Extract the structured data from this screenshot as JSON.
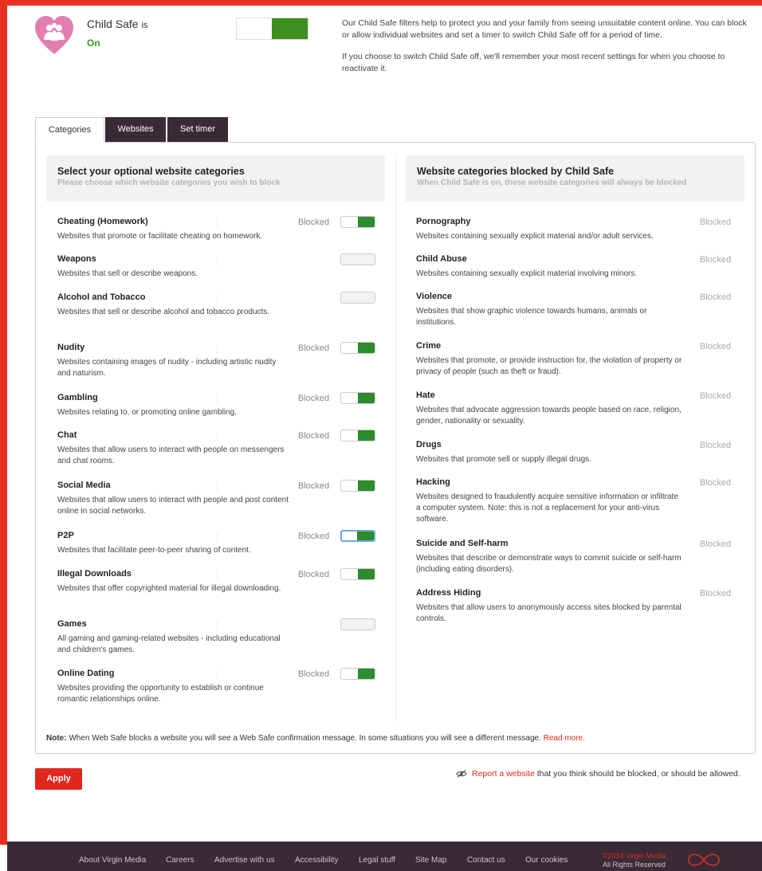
{
  "header": {
    "title": "Child Safe",
    "title_suffix": "is",
    "status": "On",
    "intro_1": "Our Child Safe filters help to protect you and your family from seeing unsuitable content online. You can block or allow individual websites and set a timer to switch Child Safe off for a period of time.",
    "intro_2": "If you choose to switch Child Safe off, we'll remember your most recent settings for when you choose to reactivate it.",
    "toggle_on": true
  },
  "tabs": [
    "Categories",
    "Websites",
    "Set timer"
  ],
  "optional": {
    "heading": "Select your optional website categories",
    "subheading": "Please choose which website categories you wish to block",
    "items": [
      {
        "name": "Cheating (Homework)",
        "desc": "Websites that promote or facilitate cheating on homework.",
        "status": "Blocked",
        "on": true
      },
      {
        "name": "Weapons",
        "desc": "Websites that sell or describe weapons.",
        "status": "",
        "on": false
      },
      {
        "name": "Alcohol and Tobacco",
        "desc": "Websites that sell or describe alcohol and tobacco products.",
        "status": "",
        "on": false
      },
      {
        "name": "Nudity",
        "desc": "Websites containing images of nudity - including artistic nudity and naturism.",
        "status": "Blocked",
        "on": true
      },
      {
        "name": "Gambling",
        "desc": "Websites relating to, or promoting online gambling.",
        "status": "Blocked",
        "on": true
      },
      {
        "name": "Chat",
        "desc": "Websites that allow users to interact with people on messengers and chat rooms.",
        "status": "Blocked",
        "on": true
      },
      {
        "name": "Social Media",
        "desc": "Websites that allow users to interact with people and post content online in social networks.",
        "status": "Blocked",
        "on": true
      },
      {
        "name": "P2P",
        "desc": "Websites that facilitate peer-to-peer sharing of content.",
        "status": "Blocked",
        "on": true
      },
      {
        "name": "Illegal Downloads",
        "desc": "Websites that offer copyrighted material for illegal downloading.",
        "status": "Blocked",
        "on": true
      },
      {
        "name": "Games",
        "desc": "All gaming and gaming-related websites - including educational and children's games.",
        "status": "",
        "on": false
      },
      {
        "name": "Online Dating",
        "desc": "Websites providing the opportunity to establish or continue romantic relationships online.",
        "status": "Blocked",
        "on": true
      }
    ]
  },
  "always": {
    "heading": "Website categories blocked by Child Safe",
    "subheading": "When Child Safe is on, these website categories will always be blocked",
    "items": [
      {
        "name": "Pornography",
        "desc": "Websites containing sexually explicit material and/or adult services.",
        "status": "Blocked"
      },
      {
        "name": "Child Abuse",
        "desc": "Websites containing sexually explicit material involving minors.",
        "status": "Blocked"
      },
      {
        "name": "Violence",
        "desc": "Websites that show graphic violence towards humans, animals or institutions.",
        "status": "Blocked"
      },
      {
        "name": "Crime",
        "desc": "Websites that promote, or provide instruction for, the violation of property or privacy of people (such as theft or fraud).",
        "status": "Blocked"
      },
      {
        "name": "Hate",
        "desc": "Websites that advocate aggression towards people based on race, religion, gender, nationality or sexuality.",
        "status": "Blocked"
      },
      {
        "name": "Drugs",
        "desc": "Websites that promote sell or supply illegal drugs.",
        "status": "Blocked"
      },
      {
        "name": "Hacking",
        "desc": "Websites designed to fraudulently acquire sensitive information or infiltrate a computer system. Note: this is not a replacement for your anti-virus software.",
        "status": "Blocked"
      },
      {
        "name": "Suicide and Self-harm",
        "desc": "Websites that describe or demonstrate ways to commit suicide or self-harm (including eating disorders).",
        "status": "Blocked"
      },
      {
        "name": "Address Hiding",
        "desc": "Websites that allow users to anonymously access sites blocked by parental controls.",
        "status": "Blocked"
      }
    ]
  },
  "note": {
    "label": "Note:",
    "text": " When Web Safe blocks a website you will see a Web Safe confirmation message. In some situations you will see a different message. ",
    "link": "Read more."
  },
  "apply_label": "Apply",
  "report": {
    "link": "Report a website",
    "text": " that you think should be blocked, or should be allowed."
  },
  "footer": {
    "links": [
      "About Virgin Media",
      "Careers",
      "Advertise with us",
      "Accessibility",
      "Legal stuff",
      "Site Map",
      "Contact us",
      "Our cookies"
    ],
    "copyright": "©2014 Virgin Media.",
    "rights": "All Rights Reserved"
  },
  "colors": {
    "accent": "#e1261c",
    "toggle_on": "#2e8b2e",
    "dark_tab": "#3a2a36"
  }
}
